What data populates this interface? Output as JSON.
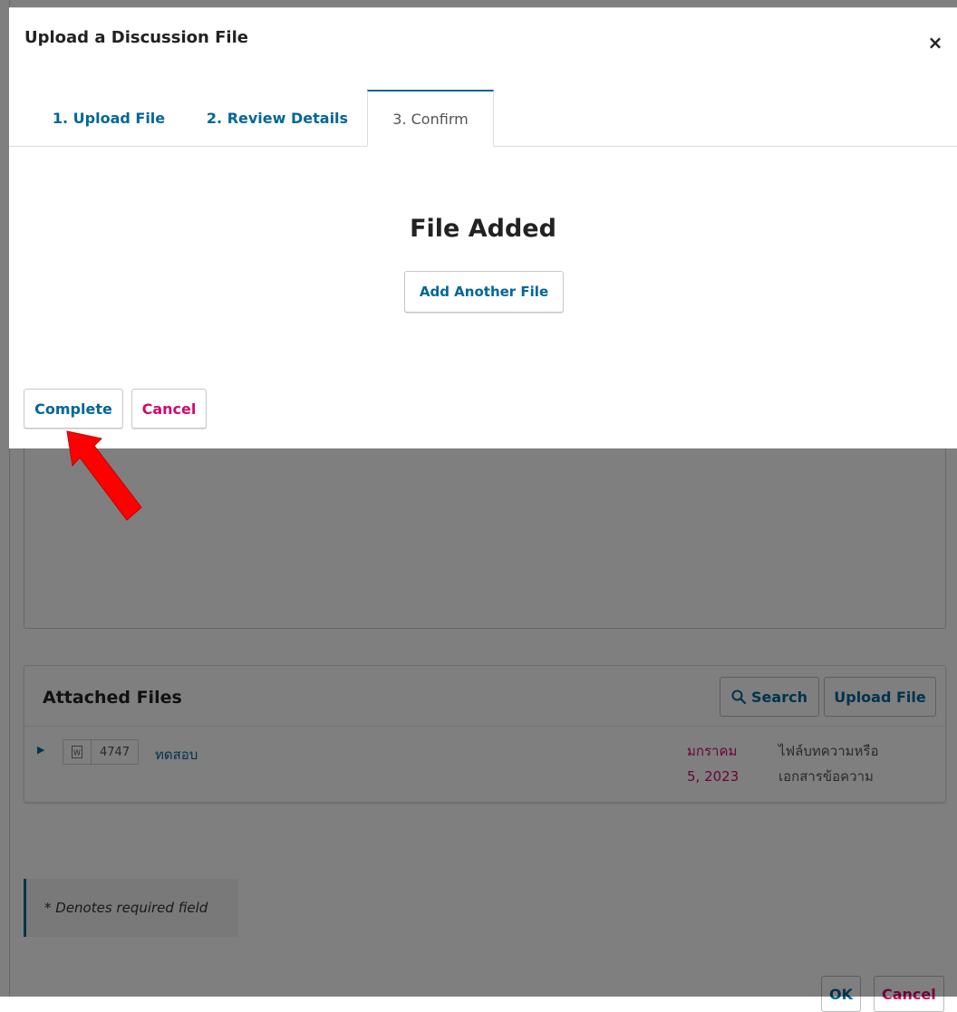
{
  "modal": {
    "title": "Upload a Discussion File",
    "close_label": "×",
    "tabs": [
      {
        "label": "1. Upload File"
      },
      {
        "label": "2. Review Details"
      },
      {
        "label": "3. Confirm"
      }
    ],
    "heading": "File Added",
    "add_another_label": "Add Another File",
    "complete_label": "Complete",
    "cancel_label": "Cancel"
  },
  "background": {
    "attached_files": {
      "title": "Attached Files",
      "search_label": "Search",
      "upload_label": "Upload File",
      "rows": [
        {
          "id": "4747",
          "name": "ทดสอบ",
          "date_line1": "มกราคม",
          "date_line2": "5, 2023",
          "type_line1": "ไฟล์บทความหรือ",
          "type_line2": "เอกสารข้อความ"
        }
      ]
    },
    "required_note": "* Denotes required field",
    "ok_label": "OK",
    "cancel_label": "Cancel"
  },
  "colors": {
    "primary": "#006798",
    "danger": "#d00a6c",
    "arrow": "#ff0000",
    "overlay": "rgba(0,0,0,0.5)"
  },
  "icons": {
    "close": "close-icon",
    "search": "search-icon",
    "expand": "caret-right-icon",
    "document": "document-icon",
    "annotation": "red-arrow-annotation"
  }
}
